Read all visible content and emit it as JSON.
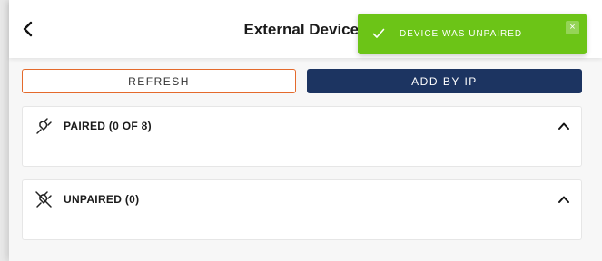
{
  "header": {
    "title": "External Devices",
    "back_icon": "chevron-left-icon"
  },
  "actions": {
    "refresh_label": "REFRESH",
    "add_by_ip_label": "ADD BY IP"
  },
  "sections": {
    "paired": {
      "label": "PAIRED (0 OF 8)",
      "icon": "plug-icon",
      "expanded": true
    },
    "unpaired": {
      "label": "UNPAIRED (0)",
      "icon": "plug-off-icon",
      "expanded": true
    }
  },
  "toast": {
    "message": "DEVICE WAS UNPAIRED",
    "icon": "check-icon",
    "close_glyph": "×"
  },
  "colors": {
    "accent_orange": "#e46a2c",
    "primary_navy": "#1c3461",
    "success_green": "#6cc417"
  }
}
